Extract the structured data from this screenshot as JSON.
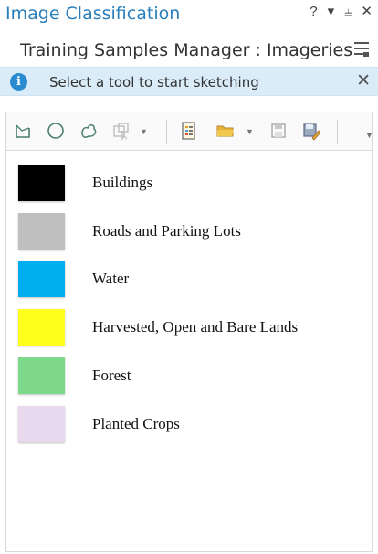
{
  "window": {
    "title": "Image Classification",
    "controls": {
      "help": "?",
      "dropdown": "▾",
      "pin": "⫨",
      "close": "✕"
    }
  },
  "header": {
    "title": "Training Samples Manager : Imageries",
    "menu_icon": "hamburger-icon"
  },
  "infobar": {
    "icon": "info-icon",
    "info_glyph": "i",
    "message": "Select a tool to start sketching",
    "close": "✕"
  },
  "toolbar": {
    "tools": [
      {
        "name": "rectangle-tool",
        "icon": "rectangle-icon"
      },
      {
        "name": "circle-tool",
        "icon": "circle-icon"
      },
      {
        "name": "freehand-tool",
        "icon": "freehand-icon"
      },
      {
        "name": "select-by-segment-tool",
        "icon": "segment-select-icon"
      },
      {
        "name": "create-schema",
        "icon": "new-schema-icon"
      },
      {
        "name": "open-schema",
        "icon": "folder-icon"
      },
      {
        "name": "save",
        "icon": "save-icon"
      },
      {
        "name": "save-as",
        "icon": "save-edit-icon"
      }
    ]
  },
  "classes": [
    {
      "label": "Buildings",
      "color": "#000000"
    },
    {
      "label": "Roads and Parking Lots",
      "color": "#bfbfbf"
    },
    {
      "label": "Water",
      "color": "#00aef0"
    },
    {
      "label": "Harvested, Open and Bare Lands",
      "color": "#ffff1e"
    },
    {
      "label": "Forest",
      "color": "#7ed889"
    },
    {
      "label": "Planted Crops",
      "color": "#e8d9ee"
    }
  ]
}
